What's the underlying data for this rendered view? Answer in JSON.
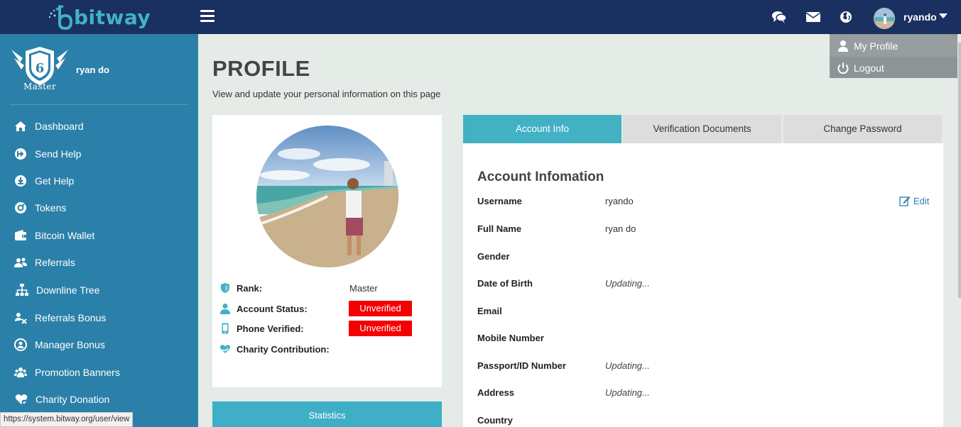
{
  "header": {
    "logo_text": "bitway",
    "username": "ryando",
    "icons": [
      "chat-icon",
      "envelope-icon",
      "globe-icon"
    ]
  },
  "dropdown": {
    "items": [
      {
        "label": "My Profile",
        "icon": "user-icon"
      },
      {
        "label": "Logout",
        "icon": "power-icon"
      }
    ]
  },
  "sidebar": {
    "rank_label": "Master",
    "rank_number": "6",
    "user_name": "ryan do",
    "items": [
      {
        "label": "Dashboard",
        "icon": "home-icon"
      },
      {
        "label": "Send Help",
        "icon": "send-icon"
      },
      {
        "label": "Get Help",
        "icon": "download-icon"
      },
      {
        "label": "Tokens",
        "icon": "token-icon"
      },
      {
        "label": "Bitcoin Wallet",
        "icon": "wallet-icon"
      },
      {
        "label": "Referrals",
        "icon": "users-icon"
      },
      {
        "label": "Downline Tree",
        "icon": "sitemap-icon"
      },
      {
        "label": "Referrals Bonus",
        "icon": "bonus-icon"
      },
      {
        "label": "Manager Bonus",
        "icon": "manager-icon"
      },
      {
        "label": "Promotion Banners",
        "icon": "banner-icon"
      },
      {
        "label": "Charity Donation",
        "icon": "heart-icon"
      }
    ]
  },
  "status_url": "https://system.bitway.org/user/view",
  "page": {
    "title": "PROFILE",
    "subtitle": "View and update your personal information on this page"
  },
  "profile_card": {
    "rank_label": "Rank:",
    "rank_value": "Master",
    "account_status_label": "Account Status:",
    "account_status_value": "Unverified",
    "phone_verified_label": "Phone Verified:",
    "phone_verified_value": "Unverified",
    "charity_label": "Charity Contribution:",
    "statistics_label": "Statistics"
  },
  "tabs": [
    {
      "label": "Account Info",
      "active": true
    },
    {
      "label": "Verification Documents",
      "active": false
    },
    {
      "label": "Change Password",
      "active": false
    }
  ],
  "account_info": {
    "title": "Account Infomation",
    "edit_label": "Edit",
    "fields": [
      {
        "label": "Username",
        "value": "ryando"
      },
      {
        "label": "Full Name",
        "value": "ryan do"
      },
      {
        "label": "Gender",
        "value": ""
      },
      {
        "label": "Date of Birth",
        "value": "Updating..."
      },
      {
        "label": "Email",
        "value": ""
      },
      {
        "label": "Mobile Number",
        "value": ""
      },
      {
        "label": "Passport/ID Number",
        "value": "Updating..."
      },
      {
        "label": "Address",
        "value": "Updating..."
      },
      {
        "label": "Country",
        "value": ""
      }
    ]
  },
  "colors": {
    "topbar": "#1a3060",
    "sidebar": "#2b80a9",
    "accent": "#42b1c4",
    "unverified": "#f40000",
    "logo": "#3fb3c6"
  }
}
